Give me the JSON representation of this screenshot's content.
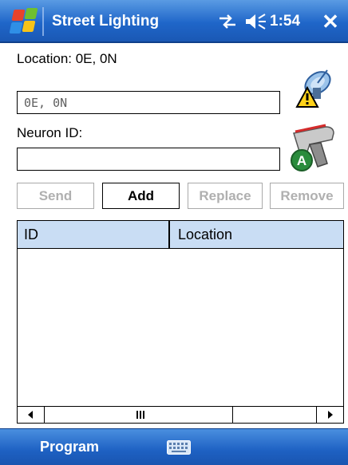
{
  "titlebar": {
    "title": "Street Lighting",
    "time": "1:54",
    "icons": [
      "windows-start-icon",
      "connectivity-icon",
      "volume-icon",
      "close-icon"
    ]
  },
  "form": {
    "location_label": "Location:  0E, 0N",
    "location_value": "0E, 0N",
    "neuron_label": "Neuron ID:",
    "neuron_value": ""
  },
  "buttons": {
    "send": "Send",
    "add": "Add",
    "replace": "Replace",
    "remove": "Remove"
  },
  "list": {
    "columns": [
      "ID",
      "Location"
    ],
    "rows": []
  },
  "menubar": {
    "left_softkey": "Program"
  },
  "colors": {
    "bar_blue": "#1f66c9",
    "header_blue": "#c9ddf4",
    "disabled_text": "#b0b0b0"
  }
}
